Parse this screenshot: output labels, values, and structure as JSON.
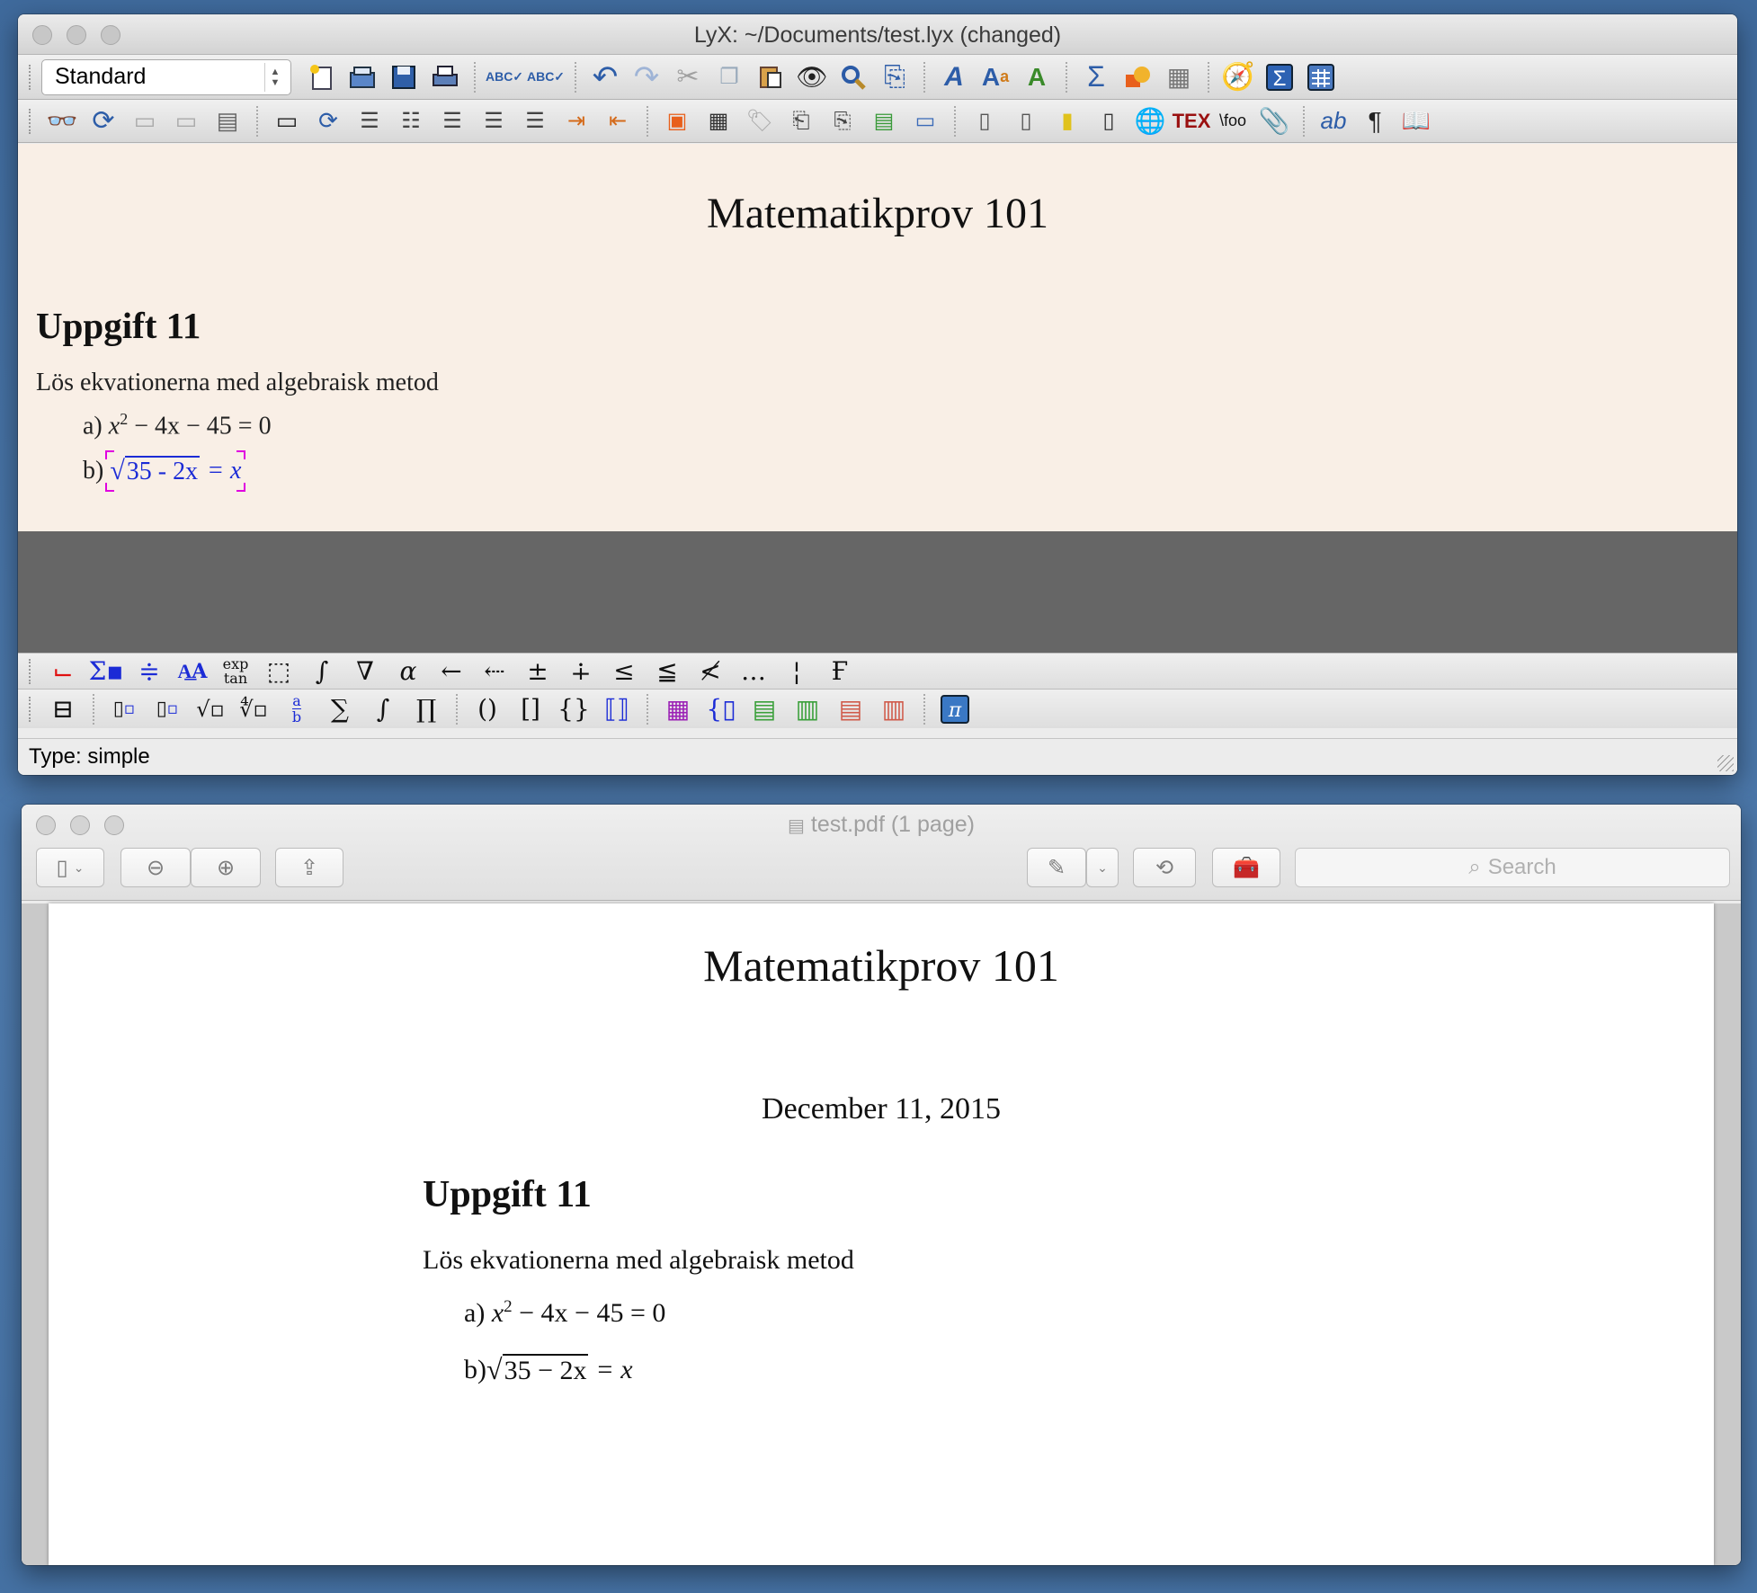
{
  "lyx": {
    "title": "LyX: ~/Documents/test.lyx (changed)",
    "layout_select": "Standard",
    "doc": {
      "title": "Matematikprov 101",
      "section": "Uppgift 11",
      "intro": "Lös ekvationerna med algebraisk metod",
      "eq_a_label": "a)",
      "eq_a_var": "x",
      "eq_a_exp": "2",
      "eq_a_rest": "− 4x − 45 = 0",
      "eq_b_label": "b)",
      "eq_b_radicand": "35 - 2x",
      "eq_b_rhs": "= x"
    },
    "math_toolbar": {
      "exp_label": "exp",
      "tan_label": "tan",
      "frac_a": "a",
      "frac_b": "b"
    },
    "status": "Type: simple"
  },
  "preview": {
    "title": "test.pdf (1 page)",
    "search_placeholder": "Search",
    "pdf": {
      "title": "Matematikprov 101",
      "date": "December 11, 2015",
      "section": "Uppgift 11",
      "intro": "Lös ekvationerna med algebraisk metod",
      "eq_a_label": "a)",
      "eq_a_var": "x",
      "eq_a_exp": "2",
      "eq_a_rest": "− 4x − 45 = 0",
      "eq_b_label": "b)",
      "eq_b_radicand": "35 − 2x",
      "eq_b_rhs": "= x"
    }
  },
  "colors": {
    "desktop": "#4571a3",
    "lyx_doc_bg": "#f9efe6",
    "math_blue": "#1b2bd6",
    "inset_magenta": "#e000e0"
  }
}
